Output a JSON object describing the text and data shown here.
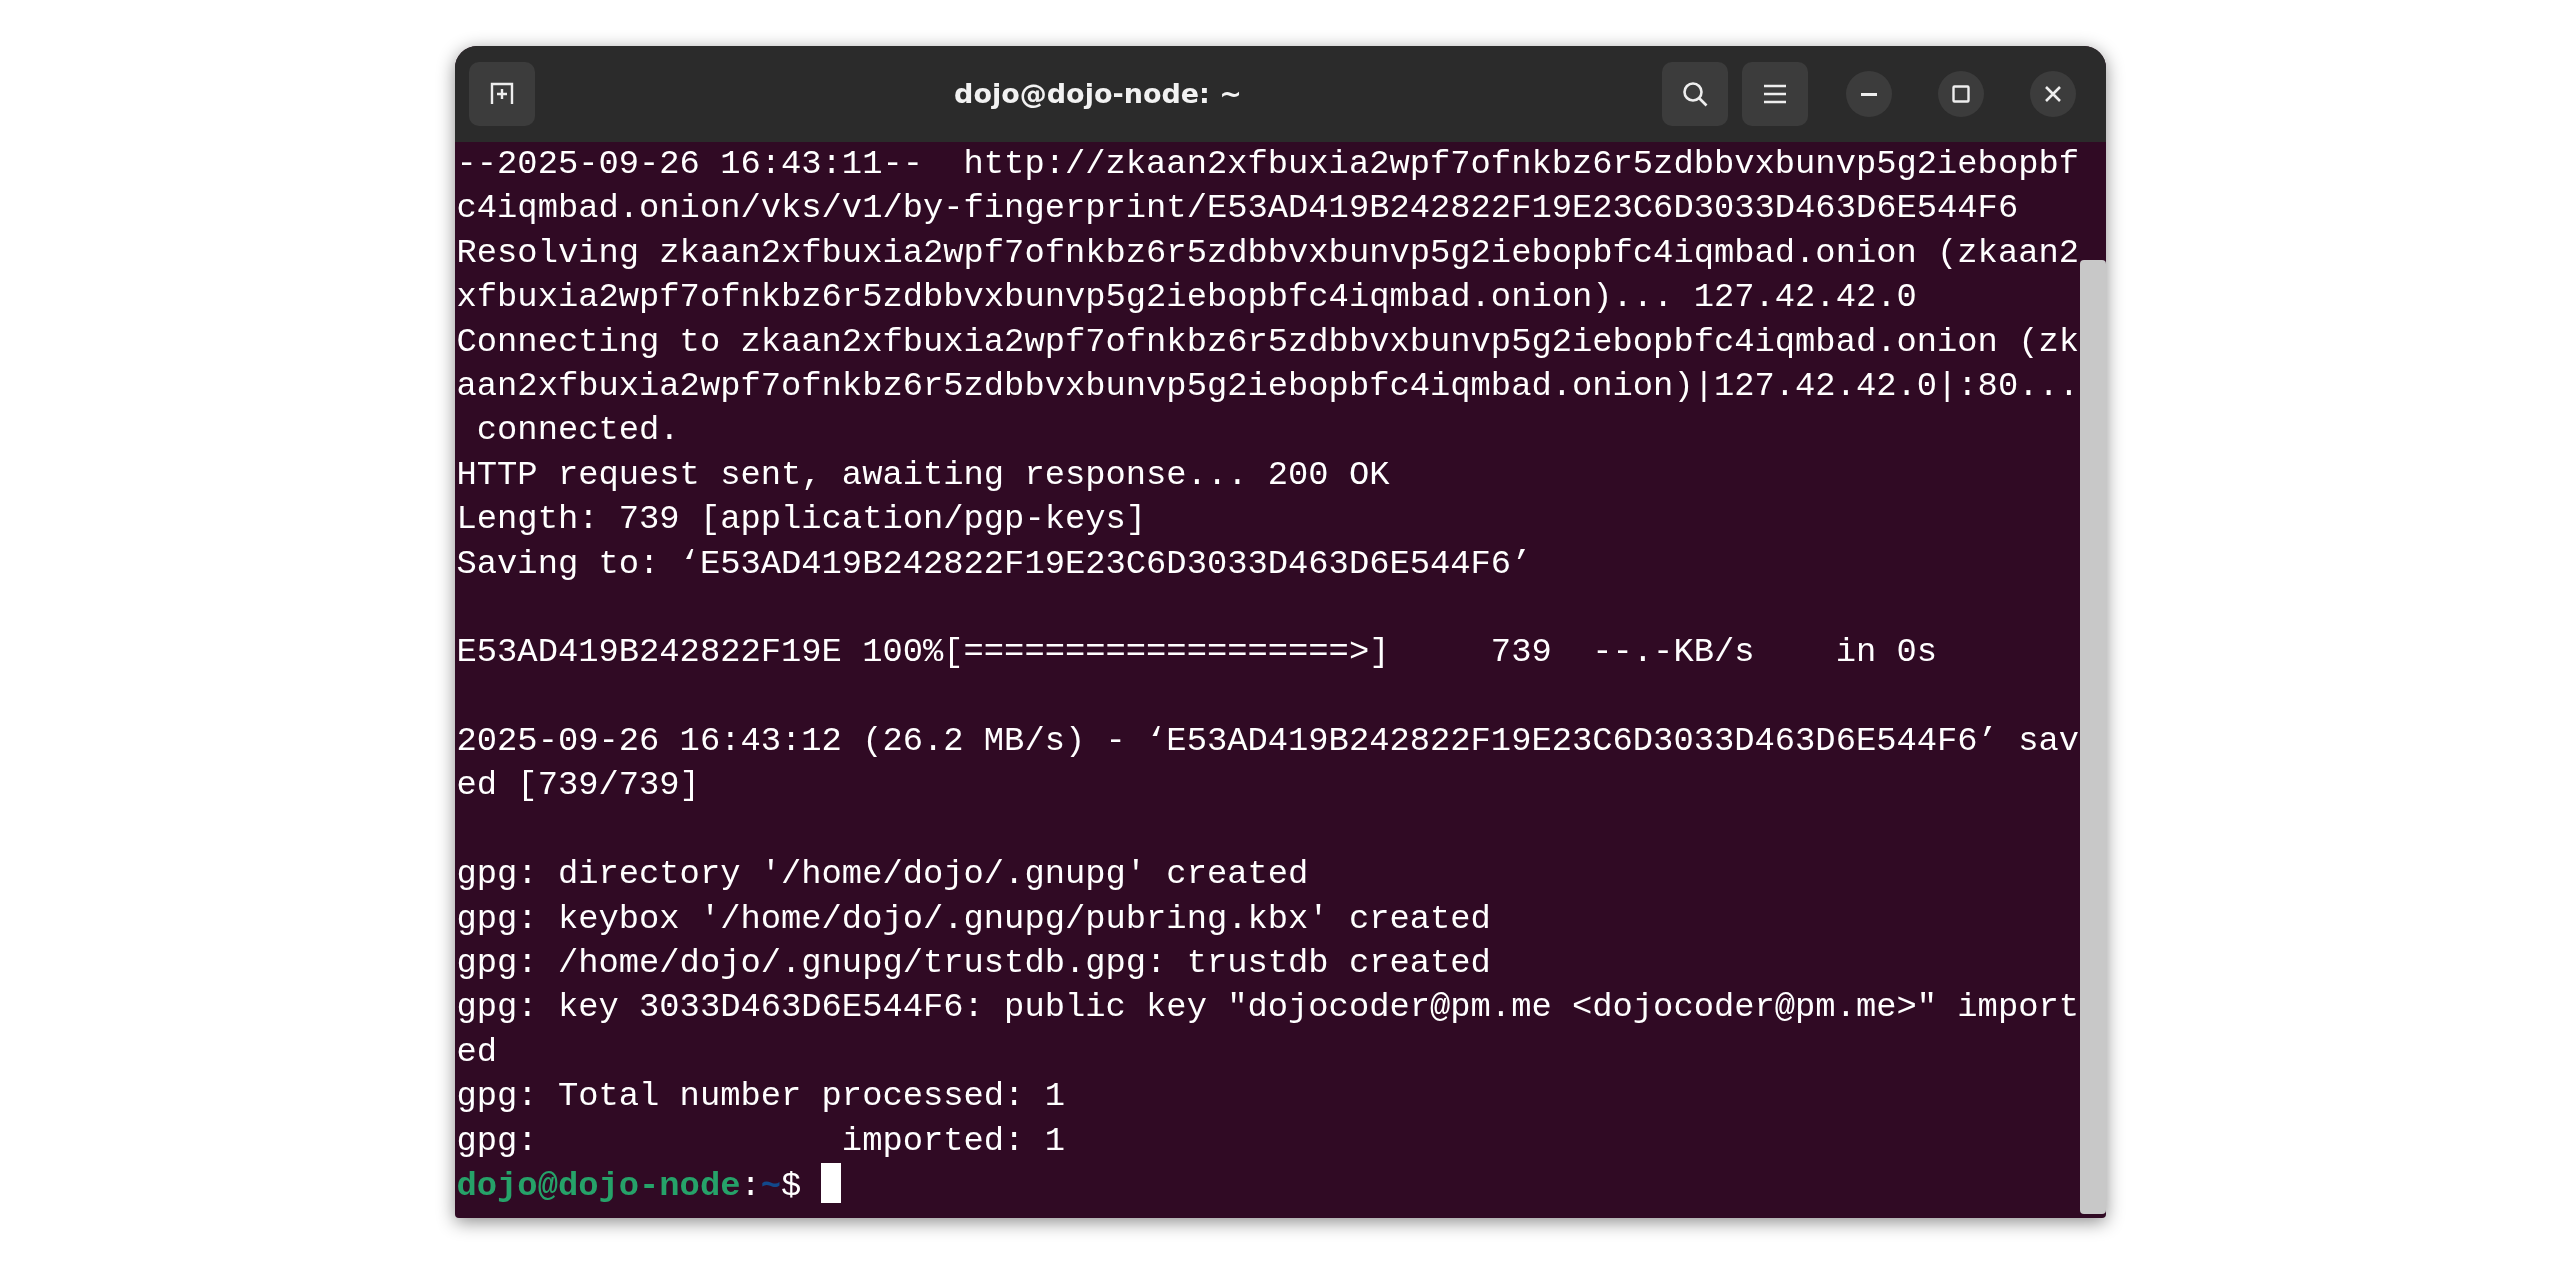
{
  "window": {
    "title": "dojo@dojo-node: ~"
  },
  "lines": [
    {
      "kind": "output",
      "text": "--2025-09-26 16:43:11--  http://zkaan2xfbuxia2wpf7ofnkbz6r5zdbbvxbunvp5g2iebopbf"
    },
    {
      "kind": "output",
      "text": "c4iqmbad.onion/vks/v1/by-fingerprint/E53AD419B242822F19E23C6D3033D463D6E544F6"
    },
    {
      "kind": "output",
      "text": "Resolving zkaan2xfbuxia2wpf7ofnkbz6r5zdbbvxbunvp5g2iebopbfc4iqmbad.onion (zkaan2"
    },
    {
      "kind": "output",
      "text": "xfbuxia2wpf7ofnkbz6r5zdbbvxbunvp5g2iebopbfc4iqmbad.onion)... 127.42.42.0"
    },
    {
      "kind": "output",
      "text": "Connecting to zkaan2xfbuxia2wpf7ofnkbz6r5zdbbvxbunvp5g2iebopbfc4iqmbad.onion (zk"
    },
    {
      "kind": "output",
      "text": "aan2xfbuxia2wpf7ofnkbz6r5zdbbvxbunvp5g2iebopbfc4iqmbad.onion)|127.42.42.0|:80..."
    },
    {
      "kind": "output",
      "text": " connected."
    },
    {
      "kind": "output",
      "text": "HTTP request sent, awaiting response... 200 OK"
    },
    {
      "kind": "output",
      "text": "Length: 739 [application/pgp-keys]"
    },
    {
      "kind": "output",
      "text": "Saving to: ‘E53AD419B242822F19E23C6D3033D463D6E544F6’"
    },
    {
      "kind": "blank"
    },
    {
      "kind": "output",
      "text": "E53AD419B242822F19E 100%[===================>]     739  --.-KB/s    in 0s"
    },
    {
      "kind": "blank"
    },
    {
      "kind": "output",
      "text": "2025-09-26 16:43:12 (26.2 MB/s) - ‘E53AD419B242822F19E23C6D3033D463D6E544F6’ sav"
    },
    {
      "kind": "output",
      "text": "ed [739/739]"
    },
    {
      "kind": "blank"
    },
    {
      "kind": "output",
      "text": "gpg: directory '/home/dojo/.gnupg' created"
    },
    {
      "kind": "output",
      "text": "gpg: keybox '/home/dojo/.gnupg/pubring.kbx' created"
    },
    {
      "kind": "output",
      "text": "gpg: /home/dojo/.gnupg/trustdb.gpg: trustdb created"
    },
    {
      "kind": "output",
      "text": "gpg: key 3033D463D6E544F6: public key \"dojocoder@pm.me <dojocoder@pm.me>\" import"
    },
    {
      "kind": "output",
      "text": "ed"
    },
    {
      "kind": "output",
      "text": "gpg: Total number processed: 1"
    },
    {
      "kind": "output",
      "text": "gpg:               imported: 1"
    },
    {
      "kind": "prompt",
      "user": "dojo@dojo-node",
      "separator": ":",
      "path": "~",
      "symbol": "$",
      "cursor": true
    }
  ]
}
